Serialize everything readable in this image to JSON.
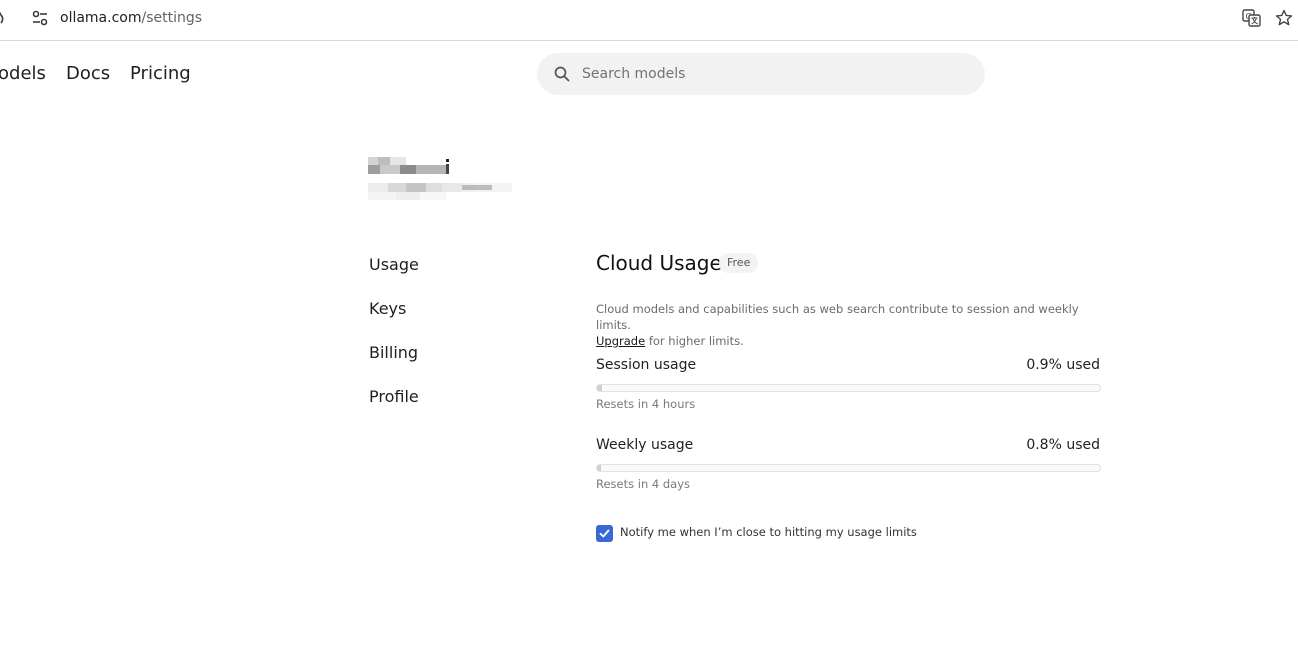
{
  "browser": {
    "url_domain": "ollama.com",
    "url_path": "/settings"
  },
  "nav": {
    "models": "odels",
    "docs": "Docs",
    "pricing": "Pricing"
  },
  "search": {
    "placeholder": "Search models"
  },
  "sidebar": {
    "items": [
      {
        "label": "Usage"
      },
      {
        "label": "Keys"
      },
      {
        "label": "Billing"
      },
      {
        "label": "Profile"
      }
    ]
  },
  "cloud_usage": {
    "title": "Cloud Usage",
    "plan_badge": "Free",
    "description": "Cloud models and capabilities such as web search contribute to session and weekly limits.",
    "upgrade_link": "Upgrade",
    "upgrade_suffix": " for higher limits.",
    "session": {
      "label": "Session usage",
      "value": "0.9% used",
      "percent": 0.9,
      "reset": "Resets in 4 hours"
    },
    "weekly": {
      "label": "Weekly usage",
      "value": "0.8% used",
      "percent": 0.8,
      "reset": "Resets in 4 days"
    },
    "notify": {
      "label": "Notify me when I’m close to hitting my usage limits",
      "checked": true
    }
  },
  "colors": {
    "checkbox": "#3a67d8",
    "search_bg": "#f2f2f2"
  }
}
